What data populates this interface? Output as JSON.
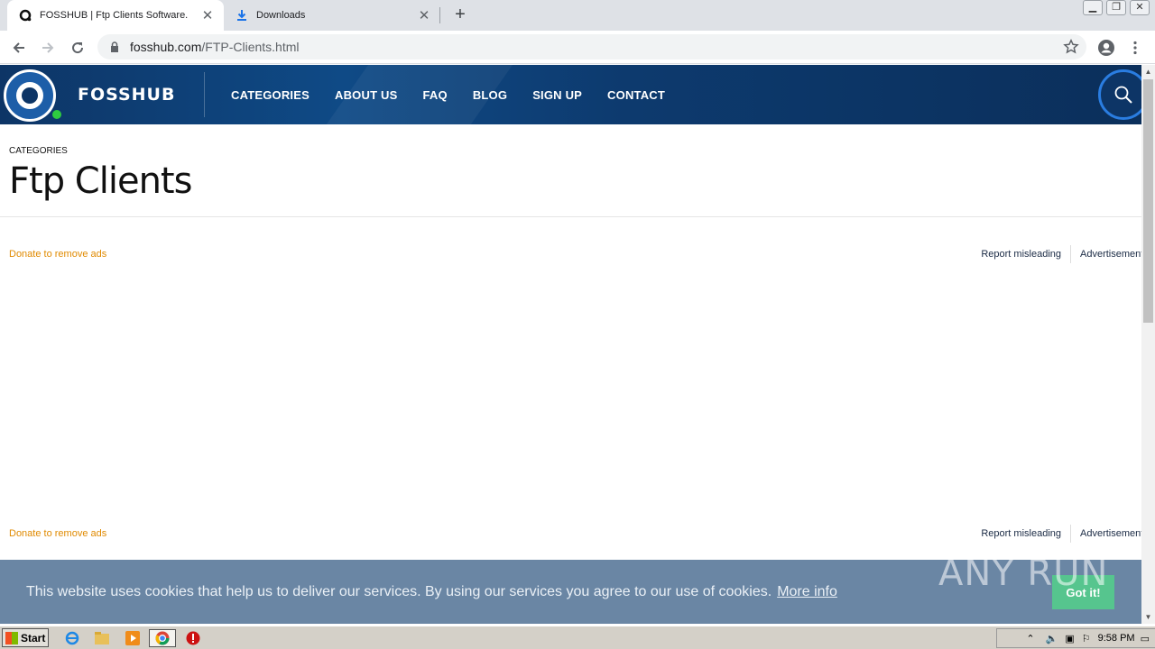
{
  "browser": {
    "tabs": [
      {
        "title": "FOSSHUB | Ftp Clients Software.",
        "active": true
      },
      {
        "title": "Downloads",
        "active": false
      }
    ],
    "new_tab_label": "+",
    "url_host": "fosshub.com",
    "url_path": "/FTP-Clients.html"
  },
  "site": {
    "brand": "FOSSHUB",
    "menu": [
      "CATEGORIES",
      "ABOUT US",
      "FAQ",
      "BLOG",
      "SIGN UP",
      "CONTACT"
    ]
  },
  "page": {
    "breadcrumb": "CATEGORIES",
    "title": "Ftp Clients"
  },
  "ads": {
    "donate": "Donate to remove ads",
    "report": "Report misleading",
    "advertisement": "Advertisement"
  },
  "cookie": {
    "message": "This website uses cookies that help us to deliver our services. By using our services you agree to our use of cookies.",
    "more_info": "More info",
    "accept": "Got it!"
  },
  "watermark": "ANY RUN",
  "taskbar": {
    "start": "Start",
    "clock": "9:58 PM"
  },
  "colors": {
    "header": "#0d3566",
    "accent_orange": "#e08a00",
    "cookie_bg": "#6a86a4",
    "cookie_button": "#56c58e"
  }
}
